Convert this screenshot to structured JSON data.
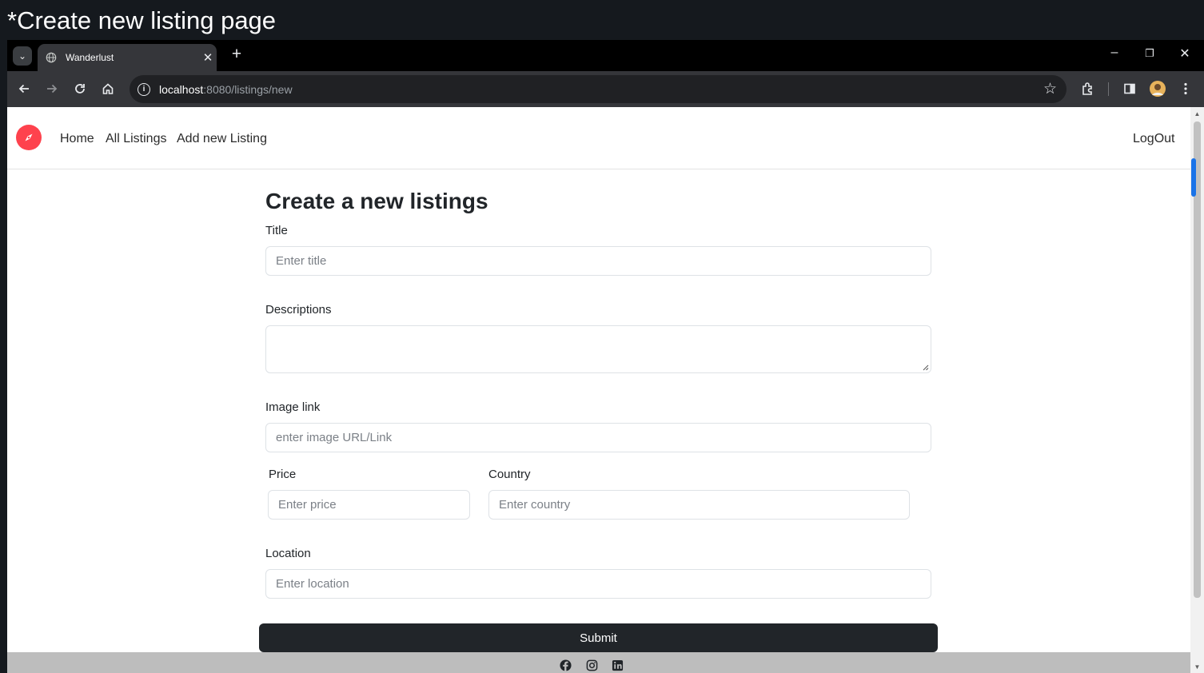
{
  "caption": "*Create new listing page",
  "browser": {
    "tab_title": "Wanderlust",
    "url_host": "localhost",
    "url_path": ":8080/listings/new",
    "new_tab": "+",
    "tab_close": "✕",
    "tab_search": "⌄",
    "minimize": "–",
    "maximize": "❐",
    "close": "✕"
  },
  "navbar": {
    "links": [
      "Home",
      "All Listings",
      "Add new Listing"
    ],
    "logout": "LogOut",
    "brand_color": "#fe424d"
  },
  "form": {
    "heading": "Create a new listings",
    "title_label": "Title",
    "title_placeholder": "Enter title",
    "description_label": "Descriptions",
    "image_label": "Image link",
    "image_placeholder": "enter image URL/Link",
    "price_label": "Price",
    "price_placeholder": "Enter price",
    "country_label": "Country",
    "country_placeholder": "Enter country",
    "location_label": "Location",
    "location_placeholder": "Enter location",
    "submit": "Submit"
  },
  "footer": {
    "icons": [
      "facebook-icon",
      "instagram-icon",
      "linkedin-icon"
    ]
  }
}
